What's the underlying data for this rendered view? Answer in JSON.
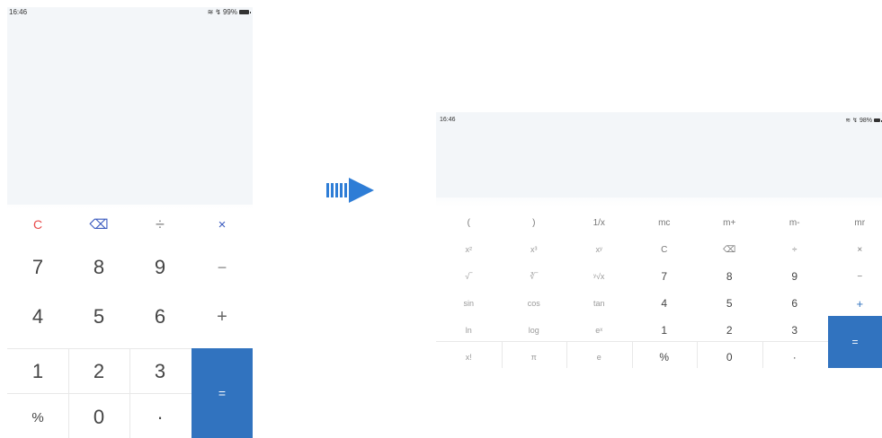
{
  "portrait": {
    "status": {
      "time": "16:46",
      "signal": "↯",
      "battery_text": "99%"
    },
    "keys": [
      [
        "C",
        "⌫",
        "÷",
        "×"
      ],
      [
        "7",
        "8",
        "9",
        "−"
      ],
      [
        "4",
        "5",
        "6",
        "+"
      ],
      [
        "1",
        "2",
        "3"
      ],
      [
        "%",
        "0",
        "·"
      ]
    ],
    "equals": "="
  },
  "arrow": {
    "color": "#2e7dd6"
  },
  "landscape": {
    "status": {
      "time": "16:46",
      "battery_text": "98%"
    },
    "keys": [
      [
        "(",
        ")",
        "1/x",
        "mc",
        "m+",
        "m-",
        "mr"
      ],
      [
        "x²",
        "x³",
        "xʸ",
        "C",
        "⌫",
        "÷",
        "×"
      ],
      [
        "√‾",
        "∛‾",
        "ʸ√x",
        "7",
        "8",
        "9",
        "−"
      ],
      [
        "sin",
        "cos",
        "tan",
        "4",
        "5",
        "6",
        "+"
      ],
      [
        "ln",
        "log",
        "eˣ",
        "1",
        "2",
        "3"
      ],
      [
        "x!",
        "π",
        "e",
        "%",
        "0",
        "·"
      ]
    ],
    "equals": "="
  },
  "colors": {
    "accent": "#3173bf",
    "clear": "#e84a4a",
    "display_bg": "#f3f6f9"
  }
}
